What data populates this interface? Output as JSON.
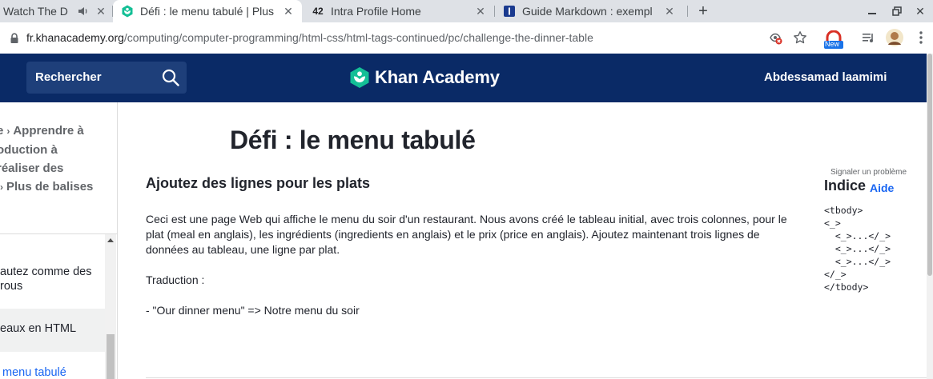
{
  "browser": {
    "tabs": [
      {
        "title": "Watch The D",
        "active": false,
        "audio": true
      },
      {
        "title": "Défi : le menu tabulé | Plus",
        "active": true
      },
      {
        "title": "Intra Profile Home",
        "active": false
      },
      {
        "title": "Guide Markdown : exempl",
        "active": false
      }
    ],
    "new_tab_label": "+",
    "url_host": "fr.khanacademy.org",
    "url_path": "/computing/computer-programming/html-css/html-tags-continued/pc/challenge-the-dinner-table",
    "extension_badge": "New"
  },
  "header": {
    "search_label": "Rechercher",
    "logo_text": "Khan Academy",
    "user_name": "Abdessamad laamimi",
    "brand_color": "#0a2a66",
    "logo_color": "#14bf96"
  },
  "sidebar": {
    "breadcrumb": [
      {
        "text": "e",
        "sep": "›",
        "text2": "Apprendre à"
      },
      {
        "text": "oduction à"
      },
      {
        "text": " réaliser des"
      },
      {
        "text": "",
        "sep": "›",
        "text2": "Plus de balises"
      }
    ],
    "items": [
      {
        "line1": "autez comme des",
        "line2": "rous"
      },
      {
        "label": "eaux en HTML"
      },
      {
        "label": "menu tabulé"
      }
    ]
  },
  "main": {
    "title": "Défi : le menu tabulé",
    "subtitle": "Ajoutez des lignes pour les plats",
    "description": {
      "paragraph": "Ceci est une page Web qui affiche le menu du soir d'un restaurant. Nous avons créé le tableau initial, avec trois colonnes, pour le plat (meal en anglais), les ingrédients (ingredients en anglais) et le prix (price en anglais). Ajoutez maintenant trois lignes de données au tableau, une ligne par plat.",
      "translation_label": "Traduction :",
      "translation_item": "- \"Our dinner menu\" => Notre menu du soir"
    }
  },
  "hint": {
    "report_label": "Signaler un problème",
    "title": "Indice",
    "help_label": "Aide",
    "code": "<tbody>\n<_>\n  <_>...</_>\n  <_>...</_>\n  <_>...</_>\n</_>\n</tbody>"
  }
}
